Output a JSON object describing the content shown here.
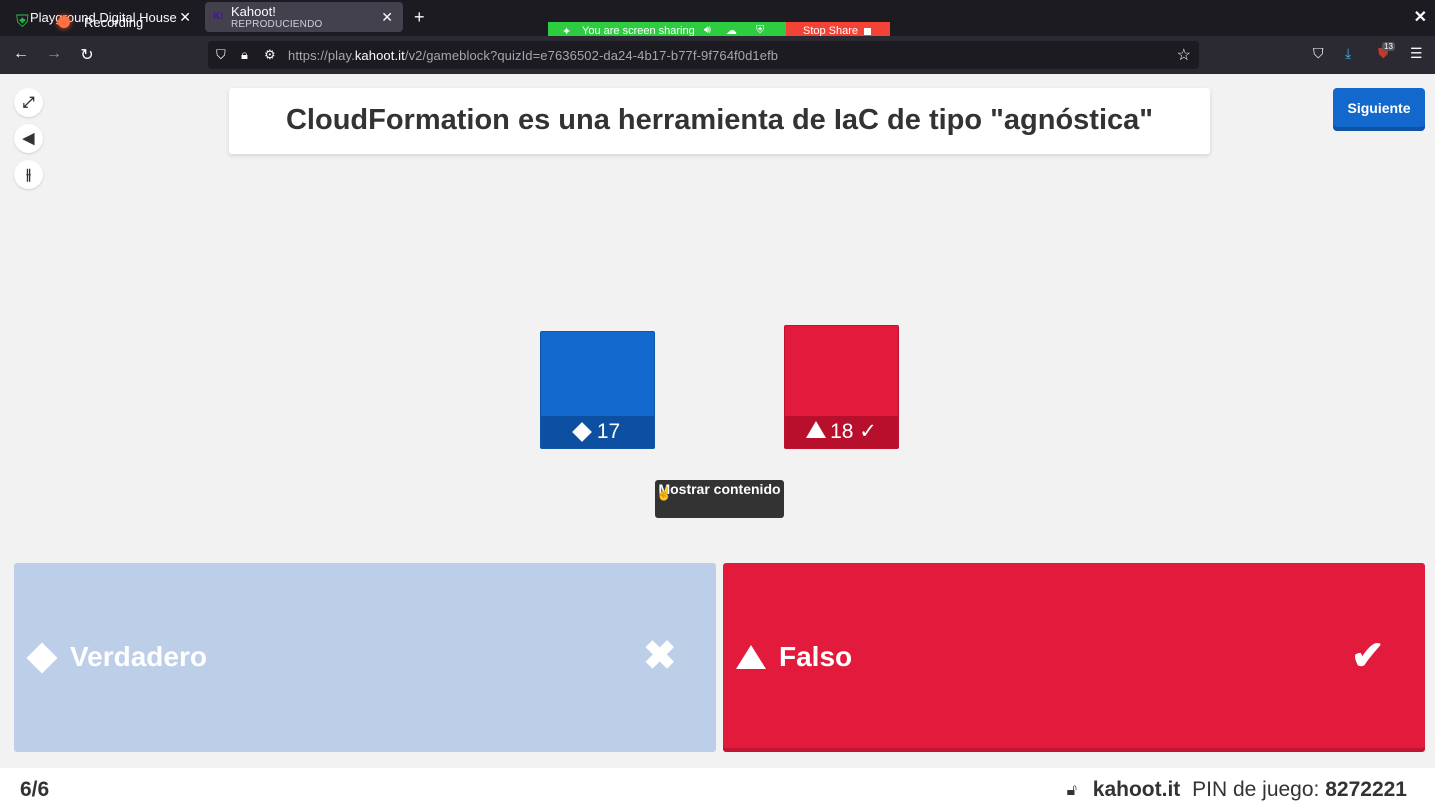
{
  "browser": {
    "tabs": [
      {
        "title": "Playground Digital House",
        "active": false
      },
      {
        "title": "Kahoot!",
        "subtitle": "REPRODUCIENDO",
        "active": true
      }
    ],
    "recording_label": "Recording",
    "screen_share": {
      "message": "You are screen sharing",
      "stop_label": "Stop Share"
    },
    "url": {
      "prefix": "https://play.",
      "host": "kahoot.it",
      "path": "/v2/gameblock?quizId=e7636502-da24-4b17-b77f-9f764f0d1efb"
    },
    "extension_badge": "13"
  },
  "icons": {
    "fullscreen": "fullscreen-icon",
    "volume": "volume-icon",
    "settings": "sliders-icon",
    "lock": "lock-icon"
  },
  "colors": {
    "blue": "#1368ce",
    "red": "#e21b3c",
    "faded_blue": "#bccee8"
  },
  "question": {
    "title": "CloudFormation es una herramienta de IaC de tipo \"agnóstica\""
  },
  "next_button": "Siguiente",
  "results": [
    {
      "shape": "diamond",
      "count": "17",
      "correct": false,
      "color": "#1368ce"
    },
    {
      "shape": "triangle",
      "count": "18",
      "correct": true,
      "color": "#e21b3c"
    }
  ],
  "show_content_button": "Mostrar contenido",
  "answers": [
    {
      "shape": "diamond",
      "label": "Verdadero",
      "correct": false
    },
    {
      "shape": "triangle",
      "label": "Falso",
      "correct": true
    }
  ],
  "footer": {
    "progress": "6/6",
    "brand": "kahoot.it",
    "pin_label": "PIN de juego:",
    "pin_value": "8272221"
  }
}
